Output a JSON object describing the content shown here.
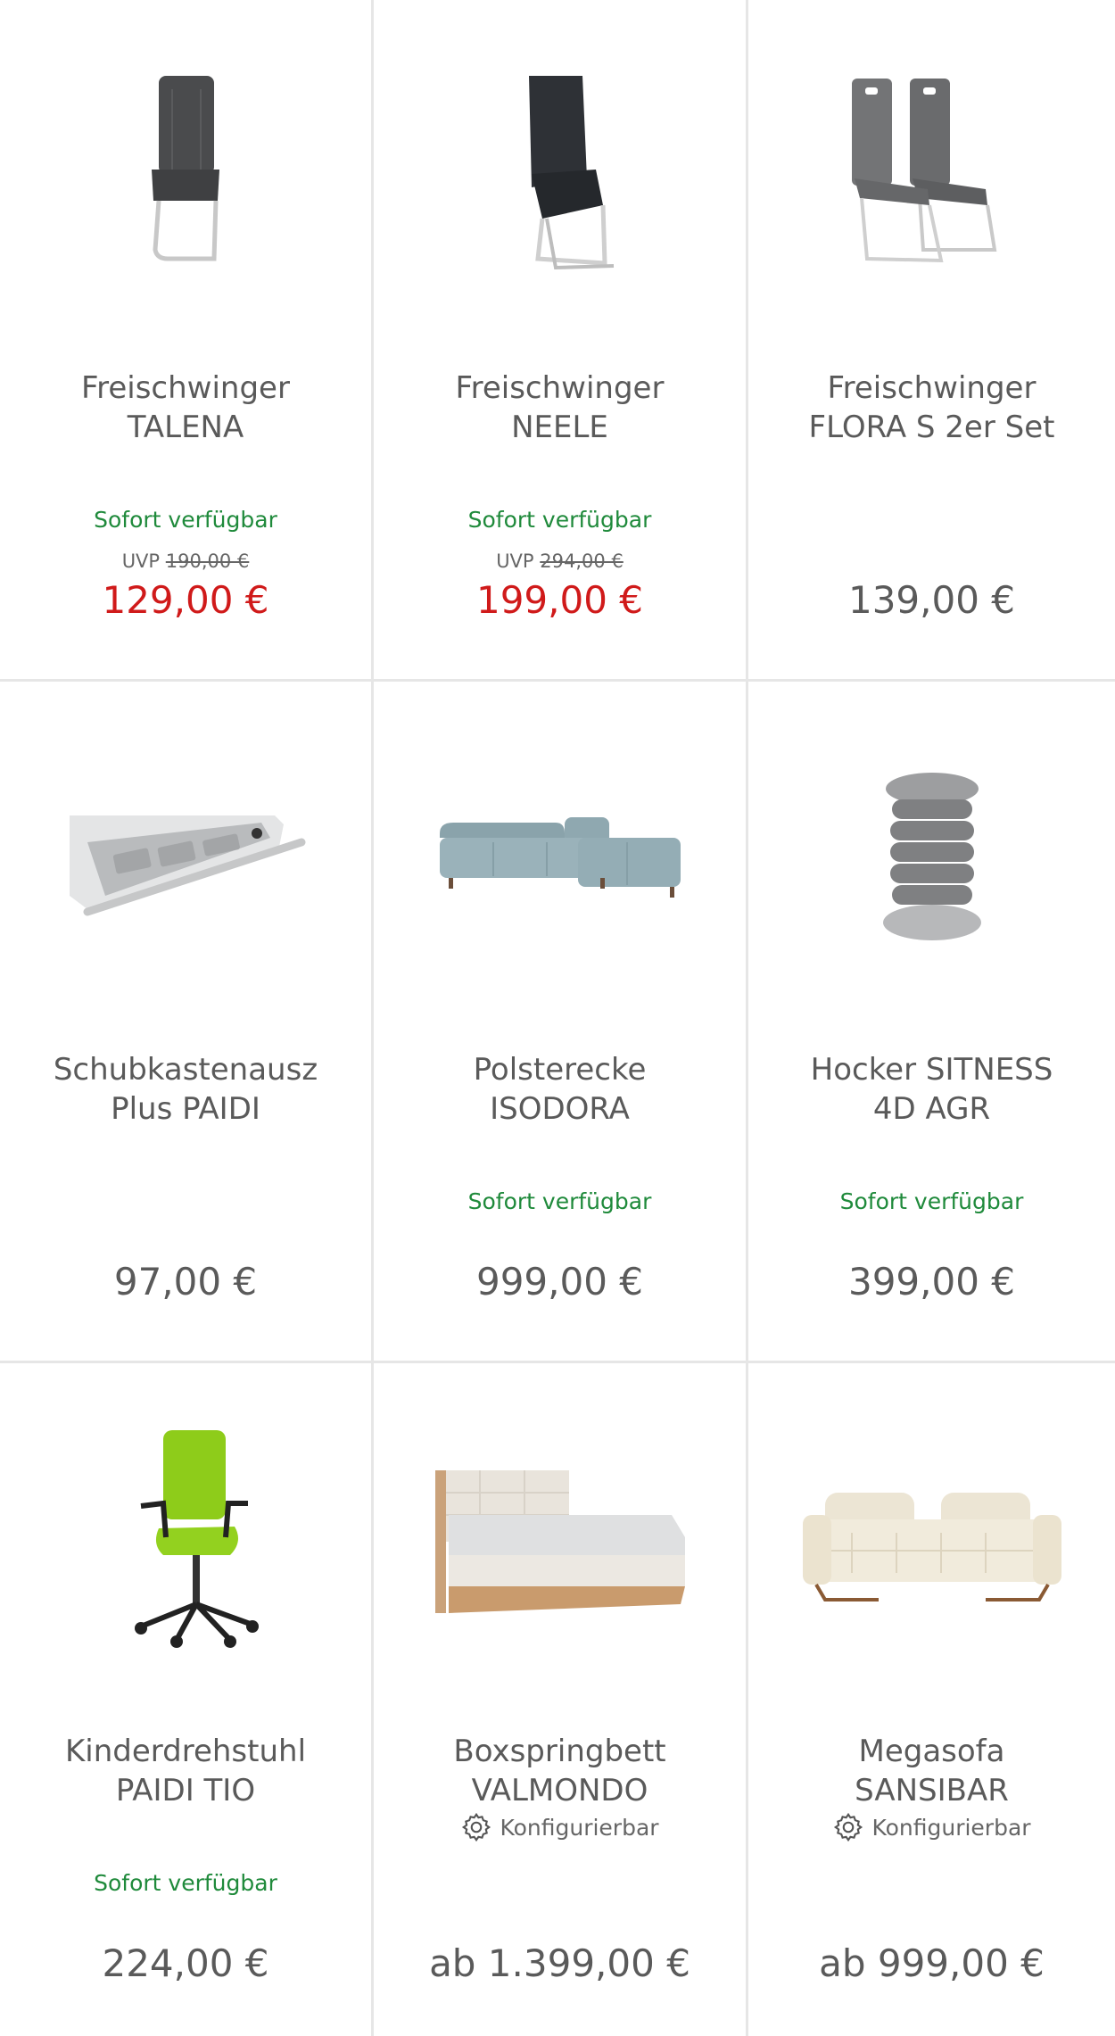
{
  "products": [
    {
      "title": "Freischwinger\nTALENA",
      "availability": "Sofort verfügbar",
      "uvp_label": "UVP",
      "uvp_price": "190,00 €",
      "price": "129,00 €",
      "on_sale": true,
      "image": "chair-dark-icon"
    },
    {
      "title": "Freischwinger\nNEELE",
      "availability": "Sofort verfügbar",
      "uvp_label": "UVP",
      "uvp_price": "294,00 €",
      "price": "199,00 €",
      "on_sale": true,
      "image": "chair-black-icon"
    },
    {
      "title": "Freischwinger\nFLORA S 2er Set",
      "availability": "",
      "uvp_label": "",
      "uvp_price": "",
      "price": "139,00 €",
      "on_sale": false,
      "image": "chair-pair-icon"
    },
    {
      "title": "Schubkastenausz\nPlus PAIDI",
      "availability": "",
      "uvp_label": "",
      "uvp_price": "",
      "price": "97,00 €",
      "on_sale": false,
      "image": "drawer-icon"
    },
    {
      "title": "Polsterecke\nISODORA",
      "availability": "Sofort verfügbar",
      "uvp_label": "",
      "uvp_price": "",
      "price": "999,00 €",
      "on_sale": false,
      "image": "corner-sofa-icon"
    },
    {
      "title": "Hocker SITNESS\n4D AGR",
      "availability": "Sofort verfügbar",
      "uvp_label": "",
      "uvp_price": "",
      "price": "399,00 €",
      "on_sale": false,
      "image": "stool-icon"
    },
    {
      "title": "Kinderdrehstuhl\nPAIDI TIO",
      "availability": "Sofort verfügbar",
      "uvp_label": "",
      "uvp_price": "",
      "price": "224,00 €",
      "on_sale": false,
      "image": "office-chair-icon"
    },
    {
      "title": "Boxspringbett\nVALMONDO",
      "availability": "",
      "uvp_label": "",
      "uvp_price": "",
      "price": "ab 1.399,00 €",
      "on_sale": false,
      "configurable": "Konfigurierbar",
      "image": "bed-icon"
    },
    {
      "title": "Megasofa\nSANSIBAR",
      "availability": "",
      "uvp_label": "",
      "uvp_price": "",
      "price": "ab 999,00 €",
      "on_sale": false,
      "configurable": "Konfigurierbar",
      "image": "sofa-icon"
    }
  ],
  "colors": {
    "available": "#1f8a3b",
    "sale": "#d01a1a",
    "text": "#5a5a5a",
    "divider": "#e6e6e6"
  }
}
